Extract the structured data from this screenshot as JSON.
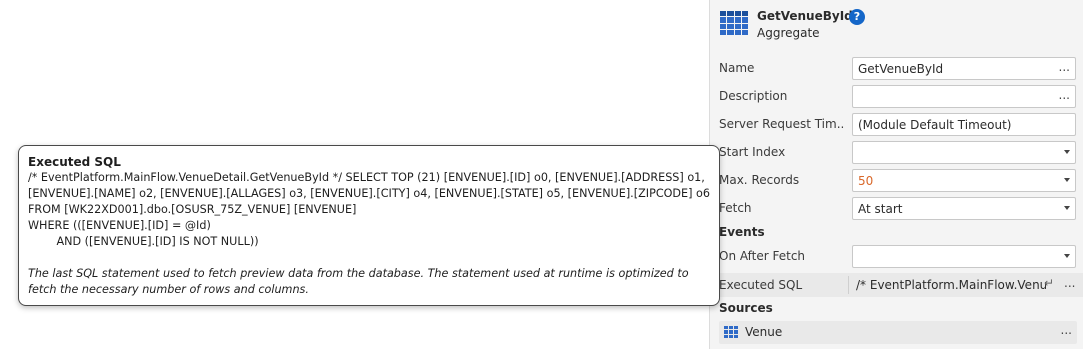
{
  "header": {
    "title": "GetVenueById",
    "subtitle": "Aggregate",
    "help": "?"
  },
  "properties": {
    "name": {
      "label": "Name",
      "value": "GetVenueById",
      "button": "..."
    },
    "description": {
      "label": "Description",
      "value": "",
      "button": "..."
    },
    "server_timeout": {
      "label": "Server Request Tim...",
      "value": "(Module Default Timeout)"
    },
    "start_index": {
      "label": "Start Index",
      "value": ""
    },
    "max_records": {
      "label": "Max. Records",
      "value": "50"
    },
    "fetch": {
      "label": "Fetch",
      "value": "At start"
    }
  },
  "events": {
    "title": "Events",
    "on_after_fetch": {
      "label": "On After Fetch",
      "value": ""
    }
  },
  "executed_sql_row": {
    "label": "Executed SQL",
    "value": "/* EventPlatform.MainFlow.VenueDetail.GetVenueById */",
    "return_icon": "↵",
    "button": "..."
  },
  "sources": {
    "title": "Sources",
    "items": [
      {
        "label": "Venue",
        "icon": "entity-icon",
        "button": "..."
      }
    ]
  },
  "tooltip": {
    "title": "Executed SQL",
    "sql": "/* EventPlatform.MainFlow.VenueDetail.GetVenueById */ SELECT TOP (21) [ENVENUE].[ID] o0, [ENVENUE].[ADDRESS] o1,\n[ENVENUE].[NAME] o2, [ENVENUE].[ALLAGES] o3, [ENVENUE].[CITY] o4, [ENVENUE].[STATE] o5, [ENVENUE].[ZIPCODE] o6\nFROM [WK22XD001].dbo.[OSUSR_75Z_VENUE] [ENVENUE]\nWHERE (([ENVENUE].[ID] = @Id)\n        AND ([ENVENUE].[ID] IS NOT NULL))",
    "note": "The last SQL statement used to fetch preview data from the database. The statement used at runtime is optimized to fetch the necessary number of rows and columns."
  },
  "colors": {
    "accent": "#1466c8",
    "number_value": "#d9682a",
    "panel_bg": "#f4f4f4"
  }
}
